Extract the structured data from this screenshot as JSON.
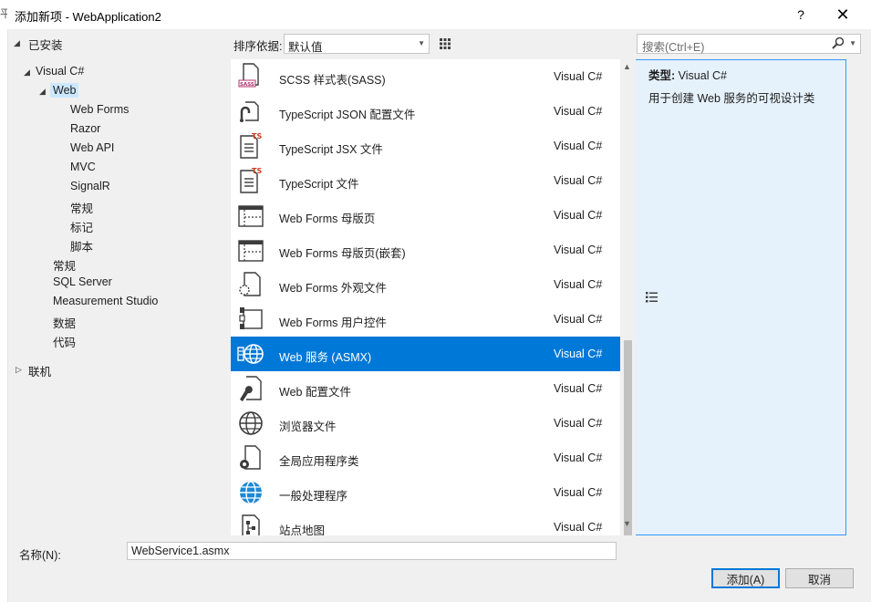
{
  "window": {
    "title": "添加新项 - WebApplication2",
    "help_glyph": "?",
    "close_glyph": "✕",
    "edge_glyph": "平"
  },
  "tree": {
    "installed": "已安装",
    "visual_csharp": "Visual C#",
    "web": "Web",
    "web_children": [
      "Web Forms",
      "Razor",
      "Web API",
      "MVC",
      "SignalR",
      "常规",
      "标记",
      "脚本"
    ],
    "cs_children": [
      "常规",
      "SQL Server",
      "Measurement Studio",
      "数据",
      "代码"
    ],
    "online": "联机"
  },
  "toolbar": {
    "sort_label": "排序依据:",
    "sort_value": "默认值"
  },
  "templates": [
    {
      "name": "SCSS 样式表(SASS)",
      "lang": "Visual C#",
      "icon": "scss-file-icon"
    },
    {
      "name": "TypeScript JSON 配置文件",
      "lang": "Visual C#",
      "icon": "json-config-icon"
    },
    {
      "name": "TypeScript JSX 文件",
      "lang": "Visual C#",
      "icon": "typescript-file-icon"
    },
    {
      "name": "TypeScript 文件",
      "lang": "Visual C#",
      "icon": "typescript-file-icon"
    },
    {
      "name": "Web Forms 母版页",
      "lang": "Visual C#",
      "icon": "master-page-icon"
    },
    {
      "name": "Web Forms 母版页(嵌套)",
      "lang": "Visual C#",
      "icon": "master-page-icon"
    },
    {
      "name": "Web Forms 外观文件",
      "lang": "Visual C#",
      "icon": "skin-file-icon"
    },
    {
      "name": "Web Forms 用户控件",
      "lang": "Visual C#",
      "icon": "user-control-icon"
    },
    {
      "name": "Web 服务 (ASMX)",
      "lang": "Visual C#",
      "icon": "web-service-icon"
    },
    {
      "name": "Web 配置文件",
      "lang": "Visual C#",
      "icon": "config-file-icon"
    },
    {
      "name": "浏览器文件",
      "lang": "Visual C#",
      "icon": "browser-file-icon"
    },
    {
      "name": "全局应用程序类",
      "lang": "Visual C#",
      "icon": "global-class-icon"
    },
    {
      "name": "一般处理程序",
      "lang": "Visual C#",
      "icon": "generic-handler-icon"
    },
    {
      "name": "站点地图",
      "lang": "Visual C#",
      "icon": "sitemap-icon"
    }
  ],
  "selected_index": 8,
  "search": {
    "placeholder": "搜索(Ctrl+E)"
  },
  "details": {
    "type_label": "类型:",
    "type_value": "Visual C#",
    "description": "用于创建 Web 服务的可视设计类"
  },
  "bottom": {
    "name_label": "名称(N):",
    "name_value": "WebService1.asmx",
    "add_label": "添加(A)",
    "cancel_label": "取消"
  },
  "colors": {
    "selection": "#0078d7",
    "tree_selection": "#cce8ff",
    "dialog_bg": "#f0f0f0"
  }
}
